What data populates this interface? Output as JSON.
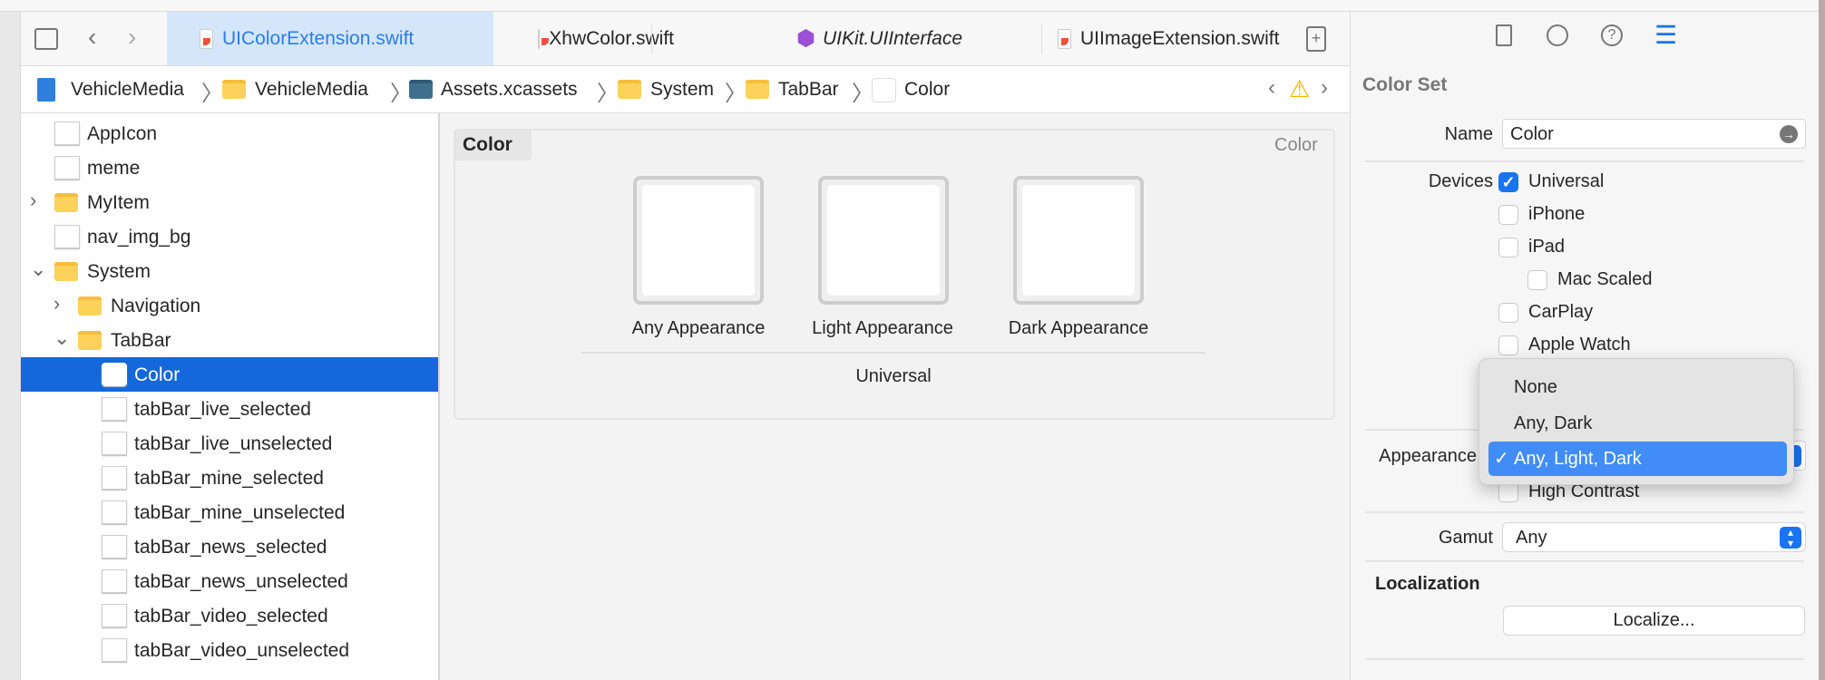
{
  "tabs": [
    {
      "label": "UIColorExtension.swift",
      "icon": "swift-file-icon",
      "active": true
    },
    {
      "label": "XhwColor.swift",
      "icon": "swift-file-icon"
    },
    {
      "label": "UIKit.UIInterface",
      "icon": "framework-icon"
    },
    {
      "label": "UIImageExtension.swift",
      "icon": "swift-file-icon"
    }
  ],
  "breadcrumb": [
    "VehicleMedia",
    "VehicleMedia",
    "Assets.xcassets",
    "System",
    "TabBar",
    "Color"
  ],
  "sidebar": {
    "items": [
      {
        "label": "AppIcon",
        "level": 0,
        "icon": "app-icon-set"
      },
      {
        "label": "meme",
        "level": 0,
        "icon": "image-set"
      },
      {
        "label": "MyItem",
        "level": 0,
        "icon": "folder",
        "chevron": "right"
      },
      {
        "label": "nav_img_bg",
        "level": 0,
        "icon": "image-set"
      },
      {
        "label": "System",
        "level": 0,
        "icon": "folder",
        "chevron": "down"
      },
      {
        "label": "Navigation",
        "level": 1,
        "icon": "folder",
        "chevron": "right"
      },
      {
        "label": "TabBar",
        "level": 1,
        "icon": "folder",
        "chevron": "down"
      },
      {
        "label": "Color",
        "level": 2,
        "icon": "color-set",
        "selected": true
      },
      {
        "label": "tabBar_live_selected",
        "level": 2,
        "icon": "image-set"
      },
      {
        "label": "tabBar_live_unselected",
        "level": 2,
        "icon": "image-set"
      },
      {
        "label": "tabBar_mine_selected",
        "level": 2,
        "icon": "image-set"
      },
      {
        "label": "tabBar_mine_unselected",
        "level": 2,
        "icon": "image-set"
      },
      {
        "label": "tabBar_news_selected",
        "level": 2,
        "icon": "image-set"
      },
      {
        "label": "tabBar_news_unselected",
        "level": 2,
        "icon": "image-set"
      },
      {
        "label": "tabBar_video_selected",
        "level": 2,
        "icon": "image-set"
      },
      {
        "label": "tabBar_video_unselected",
        "level": 2,
        "icon": "image-set"
      }
    ]
  },
  "editor": {
    "title": "Color",
    "type_label": "Color",
    "swatches": [
      {
        "label": "Any Appearance",
        "color": "#ffffff"
      },
      {
        "label": "Light Appearance",
        "color": "#ffffff"
      },
      {
        "label": "Dark Appearance",
        "color": "#ffffff"
      }
    ],
    "group_label": "Universal"
  },
  "inspector": {
    "section": "Color Set",
    "name_label": "Name",
    "name_value": "Color",
    "devices_label": "Devices",
    "devices": [
      {
        "label": "Universal",
        "checked": true
      },
      {
        "label": "iPhone",
        "checked": false
      },
      {
        "label": "iPad",
        "checked": false
      },
      {
        "label": "Mac Scaled",
        "checked": false,
        "indent": true
      },
      {
        "label": "CarPlay",
        "checked": false
      },
      {
        "label": "Apple Watch",
        "checked": false
      }
    ],
    "appearances_label": "Appearance",
    "appearance_menu": [
      {
        "label": "None"
      },
      {
        "label": "Any, Dark"
      },
      {
        "label": "Any, Light, Dark",
        "selected": true
      }
    ],
    "high_contrast": "High Contrast",
    "gamut_label": "Gamut",
    "gamut_value": "Any",
    "localization_title": "Localization",
    "localize_button": "Localize..."
  },
  "colors": {
    "accent": "#1568db",
    "tab_active_bg": "#d5e6fb",
    "tab_active_text": "#2b7de9"
  }
}
